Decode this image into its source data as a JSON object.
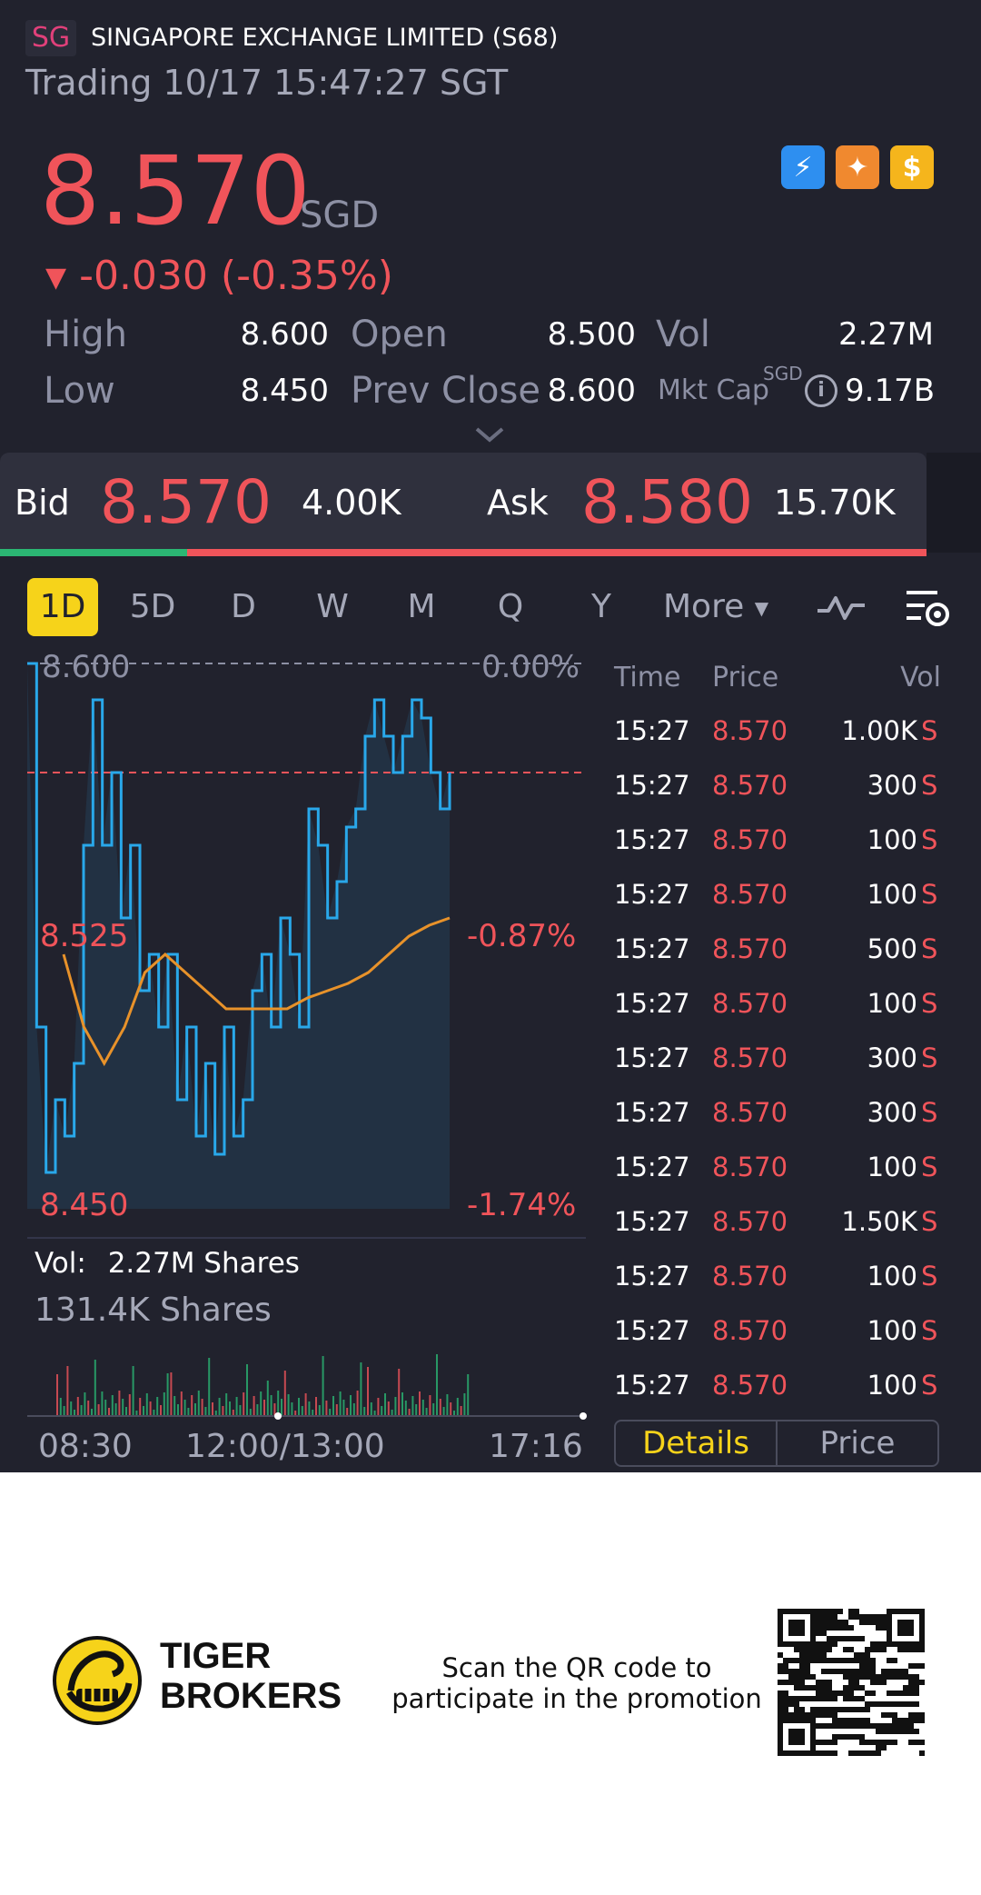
{
  "header": {
    "market_badge": "SG",
    "stock_name": "SINGAPORE EXCHANGE LIMITED (S68)",
    "status_line": "Trading 10/17 15:47:27 SGT"
  },
  "quote": {
    "price": "8.570",
    "currency": "SGD",
    "change_arrow": "▼",
    "change": "-0.030 (-0.35%)",
    "badges": [
      {
        "icon": "lightning-icon",
        "glyph": "⚡"
      },
      {
        "icon": "chart-icon",
        "glyph": "✦"
      },
      {
        "icon": "dollar-icon",
        "glyph": "$"
      }
    ]
  },
  "stats": {
    "high_label": "High",
    "high": "8.600",
    "open_label": "Open",
    "open": "8.500",
    "vol_label": "Vol",
    "vol": "2.27M",
    "low_label": "Low",
    "low": "8.450",
    "prev_close_label": "Prev Close",
    "prev_close": "8.600",
    "mkt_cap_label": "Mkt Cap",
    "mkt_cap_currency": "SGD",
    "mkt_cap": "9.17B"
  },
  "bid_ask": {
    "bid_label": "Bid",
    "bid_price": "8.570",
    "bid_qty": "4.00K",
    "ask_label": "Ask",
    "ask_price": "8.580",
    "ask_qty": "15.70K",
    "bid_ratio": 0.2
  },
  "timeframes": [
    "1D",
    "5D",
    "D",
    "W",
    "M",
    "Q",
    "Y",
    "More"
  ],
  "active_timeframe": "1D",
  "chart": {
    "top_price": "8.600",
    "top_pct": "0.00%",
    "mid_price": "8.525",
    "mid_pct": "-0.87%",
    "low_price": "8.450",
    "low_pct": "-1.74%",
    "vol_label": "Vol:",
    "vol_value": "2.27M Shares",
    "vol_axis": "131.4K Shares",
    "x_labels": [
      "08:30",
      "12:00/13:00",
      "17:16"
    ],
    "colors": {
      "price_line": "#29a8ea",
      "avg_line": "#e8922a",
      "prev_close": "#f0545a"
    }
  },
  "chart_data": {
    "type": "line",
    "title": "",
    "xlabel": "",
    "ylabel": "",
    "ylim": [
      8.45,
      8.6
    ],
    "x_ticks": [
      "08:30",
      "12:00/13:00",
      "17:16"
    ],
    "y_ticks": [
      "8.600",
      "8.525",
      "8.450"
    ],
    "y_ticks_right": [
      "0.00%",
      "-0.87%",
      "-1.74%"
    ],
    "prev_close": 8.6,
    "series": [
      {
        "values": [
          8.6,
          8.5,
          8.46,
          8.48,
          8.47,
          8.49,
          8.55,
          8.59,
          8.55,
          8.57,
          8.53,
          8.55,
          8.51,
          8.52,
          8.5,
          8.52,
          8.48,
          8.5,
          8.47,
          8.49,
          8.465,
          8.5,
          8.47,
          8.48,
          8.51,
          8.52,
          8.5,
          8.53,
          8.52,
          8.5,
          8.56,
          8.55,
          8.53,
          8.54,
          8.555,
          8.56,
          8.58,
          8.59,
          8.58,
          8.57,
          8.58,
          8.59,
          8.585,
          8.57,
          8.56,
          8.57
        ]
      },
      {
        "values": [
          8.52,
          8.5,
          8.49,
          8.5,
          8.515,
          8.52,
          8.515,
          8.51,
          8.505,
          8.505,
          8.505,
          8.505,
          8.508,
          8.51,
          8.512,
          8.515,
          8.52,
          8.525,
          8.528,
          8.53
        ]
      }
    ]
  },
  "trades": {
    "headers": {
      "time": "Time",
      "price": "Price",
      "vol": "Vol"
    },
    "rows": [
      {
        "time": "15:27",
        "price": "8.570",
        "vol": "1.00K",
        "side": "S"
      },
      {
        "time": "15:27",
        "price": "8.570",
        "vol": "300",
        "side": "S"
      },
      {
        "time": "15:27",
        "price": "8.570",
        "vol": "100",
        "side": "S"
      },
      {
        "time": "15:27",
        "price": "8.570",
        "vol": "100",
        "side": "S"
      },
      {
        "time": "15:27",
        "price": "8.570",
        "vol": "500",
        "side": "S"
      },
      {
        "time": "15:27",
        "price": "8.570",
        "vol": "100",
        "side": "S"
      },
      {
        "time": "15:27",
        "price": "8.570",
        "vol": "300",
        "side": "S"
      },
      {
        "time": "15:27",
        "price": "8.570",
        "vol": "300",
        "side": "S"
      },
      {
        "time": "15:27",
        "price": "8.570",
        "vol": "100",
        "side": "S"
      },
      {
        "time": "15:27",
        "price": "8.570",
        "vol": "1.50K",
        "side": "S"
      },
      {
        "time": "15:27",
        "price": "8.570",
        "vol": "100",
        "side": "S"
      },
      {
        "time": "15:27",
        "price": "8.570",
        "vol": "100",
        "side": "S"
      },
      {
        "time": "15:27",
        "price": "8.570",
        "vol": "100",
        "side": "S"
      }
    ],
    "tabs": [
      "Details",
      "Price"
    ],
    "active_tab": "Details"
  },
  "promo": {
    "brand_line1": "TIGER",
    "brand_line2": "BROKERS",
    "message": "Scan the QR code to participate in the promotion"
  }
}
